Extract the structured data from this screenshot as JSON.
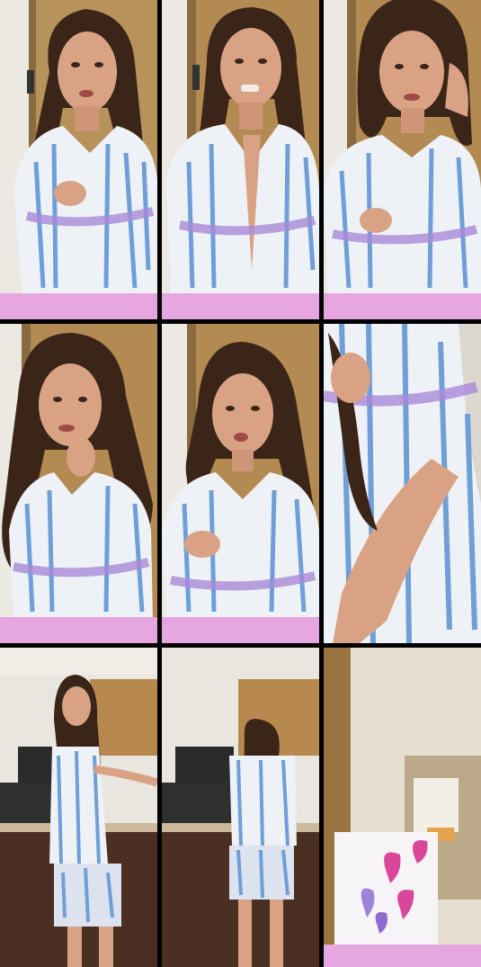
{
  "collage": {
    "rows": 3,
    "columns": 3,
    "frames": [
      {
        "scene": "selfie-close-up"
      },
      {
        "scene": "selfie-close-up"
      },
      {
        "scene": "selfie-hand-on-cheek"
      },
      {
        "scene": "selfie-hand-on-chin"
      },
      {
        "scene": "selfie-close-up"
      },
      {
        "scene": "arm-close-up"
      },
      {
        "scene": "kitchen-full-body"
      },
      {
        "scene": "kitchen-back-view"
      },
      {
        "scene": "room-with-butterfly-canvas"
      }
    ]
  },
  "colors": {
    "background": "#000000",
    "wall_tile": "#e9e6e0",
    "cabinet_wood": "#b7894f",
    "pink_surface": "#e6a6df",
    "skin": "#d9a284",
    "hair": "#3a2518",
    "shirt_white": "#eef2f6",
    "shirt_blue": "#6f9fd6",
    "shirt_purple": "#a98ad8",
    "butterfly_pink": "#d9479a"
  }
}
